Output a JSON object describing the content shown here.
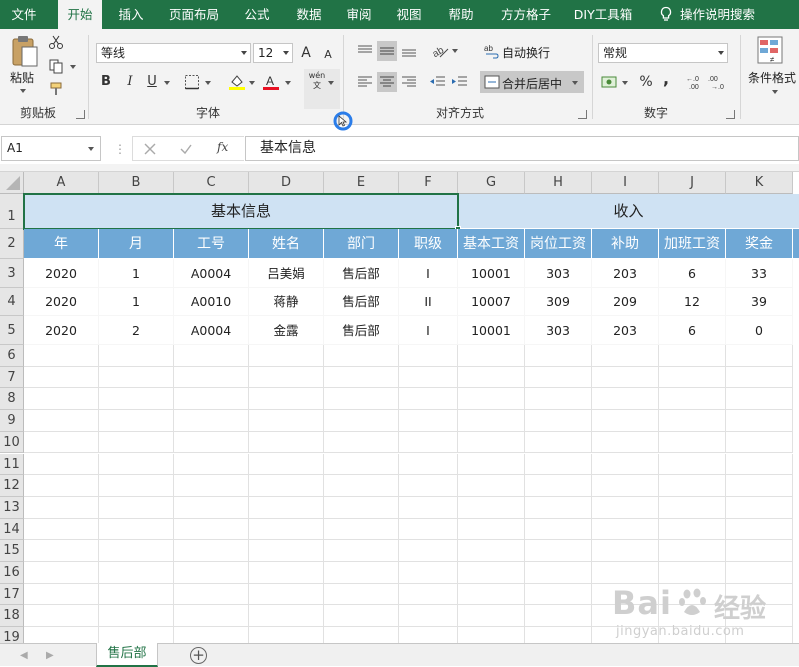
{
  "tabs": [
    {
      "label": "文件",
      "active": false
    },
    {
      "label": "开始",
      "active": true
    },
    {
      "label": "插入",
      "active": false
    },
    {
      "label": "页面布局",
      "active": false
    },
    {
      "label": "公式",
      "active": false
    },
    {
      "label": "数据",
      "active": false
    },
    {
      "label": "审阅",
      "active": false
    },
    {
      "label": "视图",
      "active": false
    },
    {
      "label": "帮助",
      "active": false
    },
    {
      "label": "方方格子",
      "active": false
    },
    {
      "label": "DIY工具箱",
      "active": false
    }
  ],
  "tell_me": "操作说明搜索",
  "ribbon": {
    "clipboard": {
      "paste_label": "粘贴",
      "group_label": "剪贴板"
    },
    "font": {
      "font_name": "等线",
      "font_size": "12",
      "group_label": "字体",
      "bold": "B",
      "italic": "I",
      "underline": "U",
      "grow": "A",
      "shrink": "A",
      "wen": "wén\n文",
      "font_color": "#e81123",
      "fill_color": "#ffff00"
    },
    "alignment": {
      "wrap_text": "自动换行",
      "merge_center": "合并后居中",
      "group_label": "对齐方式"
    },
    "number": {
      "format": "常规",
      "group_label": "数字",
      "percent": "%",
      "comma": ","
    },
    "styles": {
      "conditional": "条件格式"
    }
  },
  "formula_bar": {
    "name_box": "A1",
    "fx": "fx",
    "content": "基本信息"
  },
  "grid": {
    "columns": [
      "A",
      "B",
      "C",
      "D",
      "E",
      "F",
      "G",
      "H",
      "I",
      "J",
      "K"
    ],
    "rows": [
      "1",
      "2",
      "3",
      "4",
      "5",
      "6",
      "7",
      "8",
      "9",
      "10",
      "11",
      "12",
      "13",
      "14",
      "15",
      "16",
      "17",
      "18",
      "19"
    ],
    "merged": {
      "basic": "基本信息",
      "income": "收入"
    },
    "headers": [
      "年",
      "月",
      "工号",
      "姓名",
      "部门",
      "职级",
      "基本工资",
      "岗位工资",
      "补助",
      "加班工资",
      "奖金"
    ],
    "data": [
      [
        "2020",
        "1",
        "A0004",
        "吕美娟",
        "售后部",
        "I",
        "10001",
        "303",
        "203",
        "6",
        "33"
      ],
      [
        "2020",
        "1",
        "A0010",
        "蒋静",
        "售后部",
        "II",
        "10007",
        "309",
        "209",
        "12",
        "39"
      ],
      [
        "2020",
        "2",
        "A0004",
        "金露",
        "售后部",
        "I",
        "10001",
        "303",
        "203",
        "6",
        "0"
      ]
    ]
  },
  "sheet_tab": "售后部",
  "watermark": {
    "brand": "Bai",
    "brand2": "经验",
    "url": "jingyan.baidu.com"
  },
  "colors": {
    "excel_green": "#217346",
    "header_blue": "#6fa8d6",
    "merged_blue": "#cfe2f3"
  }
}
